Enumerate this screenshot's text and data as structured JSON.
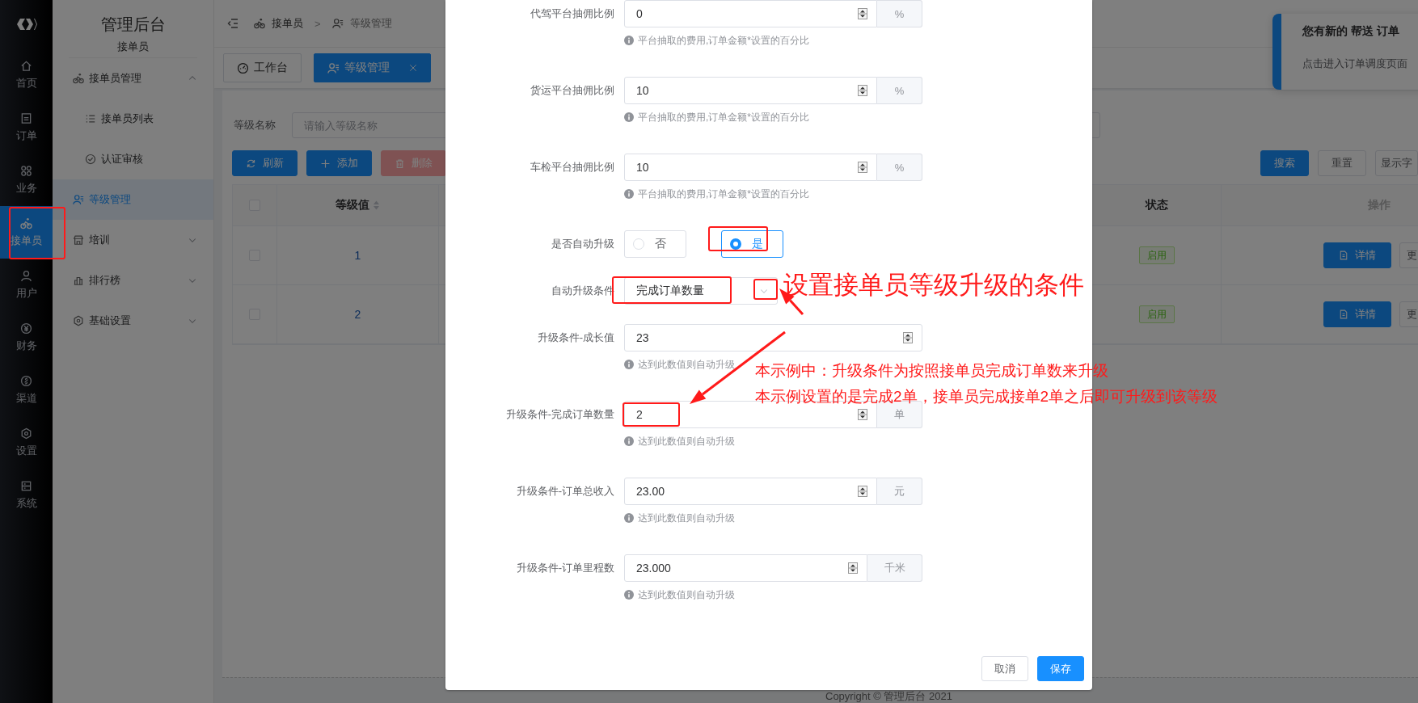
{
  "rail": {
    "items": [
      {
        "label": "首页",
        "selected": false
      },
      {
        "label": "订单",
        "selected": false
      },
      {
        "label": "业务",
        "selected": false
      },
      {
        "label": "接单员",
        "selected": true
      },
      {
        "label": "用户",
        "selected": false
      },
      {
        "label": "财务",
        "selected": false
      },
      {
        "label": "渠道",
        "selected": false
      },
      {
        "label": "设置",
        "selected": false
      },
      {
        "label": "系统",
        "selected": false
      }
    ]
  },
  "sidebar": {
    "title": "管理后台",
    "subtitle": "接单员",
    "items": [
      {
        "label": "接单员管理",
        "selected": false,
        "expanded": true,
        "children": [
          {
            "label": "接单员列表",
            "selected": false
          },
          {
            "label": "认证审核",
            "selected": false
          }
        ]
      },
      {
        "label": "等级管理",
        "selected": true
      },
      {
        "label": "培训",
        "selected": false,
        "expanded": false
      },
      {
        "label": "排行榜",
        "selected": false,
        "expanded": false
      },
      {
        "label": "基础设置",
        "selected": false,
        "expanded": false
      }
    ]
  },
  "breadcrumb": {
    "items": [
      "接单员",
      "等级管理"
    ],
    "separator": ">"
  },
  "tabs": [
    {
      "label": "工作台",
      "selected": false,
      "closable": false
    },
    {
      "label": "等级管理",
      "selected": true,
      "closable": true
    }
  ],
  "search": {
    "label": "等级名称",
    "placeholder": "请输入等级名称"
  },
  "toolbar": {
    "left": [
      {
        "label": "刷新",
        "kind": "primary",
        "disabled": false
      },
      {
        "label": "添加",
        "kind": "primary",
        "disabled": false
      },
      {
        "label": "删除",
        "kind": "danger",
        "disabled": true
      }
    ],
    "right": [
      {
        "label": "搜索",
        "kind": "primary",
        "disabled": false
      },
      {
        "label": "重置",
        "kind": "default",
        "disabled": false
      },
      {
        "label": "显示字",
        "kind": "default",
        "disabled": false
      }
    ]
  },
  "table": {
    "header_checked": false,
    "columns": [
      {
        "label": "等级值",
        "sortable": true
      },
      {
        "label": "状态",
        "sortable": false
      },
      {
        "label": "操作",
        "sortable": false
      }
    ],
    "rows": [
      {
        "checked": false,
        "level_value": "1",
        "status": "启用",
        "buttons": [
          "详情",
          "更"
        ]
      },
      {
        "checked": false,
        "level_value": "2",
        "status": "启用",
        "buttons": [
          "详情",
          "更"
        ]
      }
    ]
  },
  "footer": "Copyright © 管理后台 2021",
  "notification": {
    "title": "您有新的 帮送 订单",
    "text": "点击进入订单调度页面"
  },
  "modal": {
    "fields": [
      {
        "kind": "number",
        "label": "代驾平台抽佣比例",
        "value": "0",
        "unit": "%",
        "hint": "平台抽取的费用,订单金额*设置的百分比"
      },
      {
        "kind": "number",
        "label": "货运平台抽佣比例",
        "value": "10",
        "unit": "%",
        "hint": "平台抽取的费用,订单金额*设置的百分比"
      },
      {
        "kind": "number",
        "label": "车检平台抽佣比例",
        "value": "10",
        "unit": "%",
        "hint": "平台抽取的费用,订单金额*设置的百分比"
      },
      {
        "kind": "radio",
        "label": "是否自动升级",
        "options": [
          {
            "label": "否",
            "selected": false
          },
          {
            "label": "是",
            "selected": true
          }
        ]
      },
      {
        "kind": "select",
        "label": "自动升级条件",
        "value": "完成订单数量"
      },
      {
        "kind": "number",
        "label": "升级条件-成长值",
        "value": "23",
        "hint": "达到此数值则自动升级"
      },
      {
        "kind": "number",
        "label": "升级条件-完成订单数量",
        "value": "2",
        "unit": "单",
        "hint": "达到此数值则自动升级"
      },
      {
        "kind": "number",
        "label": "升级条件-订单总收入",
        "value": "23.00",
        "unit": "元",
        "hint": "达到此数值则自动升级"
      },
      {
        "kind": "number",
        "label": "升级条件-订单里程数",
        "value": "23.000",
        "unit": "千米",
        "hint": "达到此数值则自动升级"
      }
    ],
    "buttons": [
      {
        "label": "取消",
        "kind": "default"
      },
      {
        "label": "保存",
        "kind": "primary"
      }
    ]
  },
  "annotations": {
    "callout": "设置接单员等级升级的条件",
    "notes": [
      "本示例中：升级条件为按照接单员完成订单数来升级",
      "本示例设置的是完成2单，接单员完成接单2单之后即可升级到该等级"
    ]
  }
}
